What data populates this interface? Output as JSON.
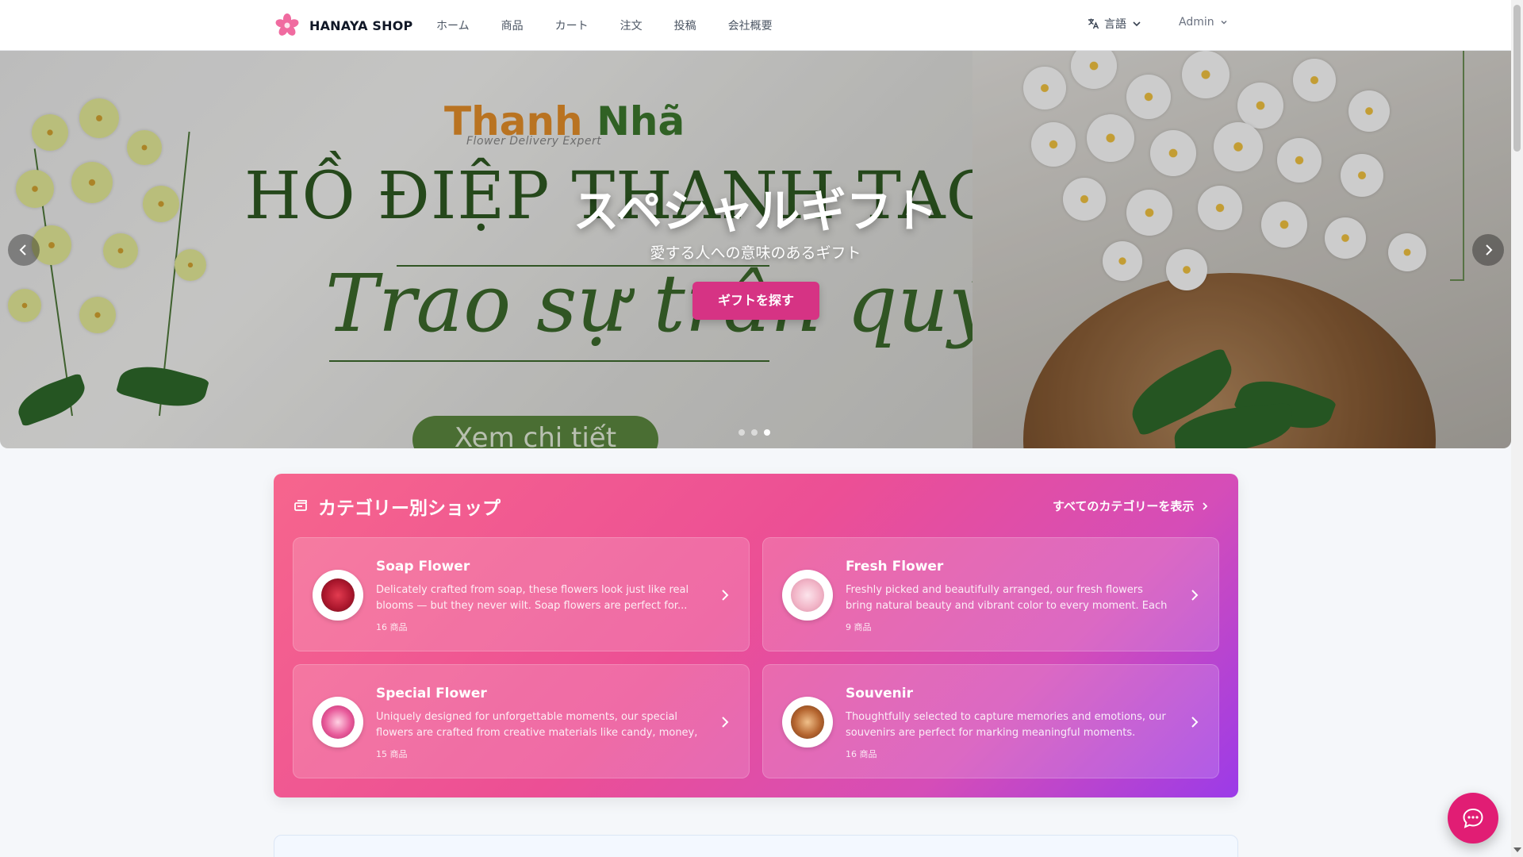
{
  "header": {
    "brand": "HANAYA SHOP",
    "nav": [
      "ホーム",
      "商品",
      "カート",
      "注文",
      "投稿",
      "会社概要"
    ],
    "language_label": "言語",
    "user_label": "Admin"
  },
  "hero": {
    "background_art": {
      "brand_part1": "Thanh",
      "brand_part2": "Nhã",
      "brand_tagline": "Flower Delivery Expert",
      "title": "HỒ ĐIỆP THANH TAO",
      "script": "Trao sự trân quý",
      "button": "Xem chi tiết"
    },
    "title": "スペシャルギフト",
    "subtitle": "愛する人への意味のあるギフト",
    "cta": "ギフトを探す",
    "slides": 3,
    "active_slide": 3
  },
  "categories": {
    "title": "カテゴリー別ショップ",
    "view_all": "すべてのカテゴリーを表示",
    "items": [
      {
        "name": "Soap Flower",
        "description": "Delicately crafted from soap, these flowers look just like real blooms — but they never wilt. Soap flowers are perfect for...",
        "count": "16 商品",
        "thumb_color": "#c41e3a"
      },
      {
        "name": "Fresh Flower",
        "description": "Freshly picked and beautifully arranged, our fresh flowers bring natural beauty and vibrant color to every moment. Each bouque...",
        "count": "9 商品",
        "thumb_color": "#f2b6c8"
      },
      {
        "name": "Special Flower",
        "description": "Uniquely designed for unforgettable moments, our special flowers are crafted from creative materials like candy, money, o...",
        "count": "15 商品",
        "thumb_color": "#e85a9a"
      },
      {
        "name": "Souvenir",
        "description": "Thoughtfully selected to capture memories and emotions, our souvenirs are perfect for marking meaningful moments. From...",
        "count": "16 商品",
        "thumb_color": "#b5652f"
      }
    ]
  },
  "colors": {
    "accent": "#d63384",
    "chat": "#e11d74"
  },
  "icons": {
    "brand": "sakura-flower-icon",
    "language": "translate-icon",
    "chat": "chat-bubble-icon"
  }
}
